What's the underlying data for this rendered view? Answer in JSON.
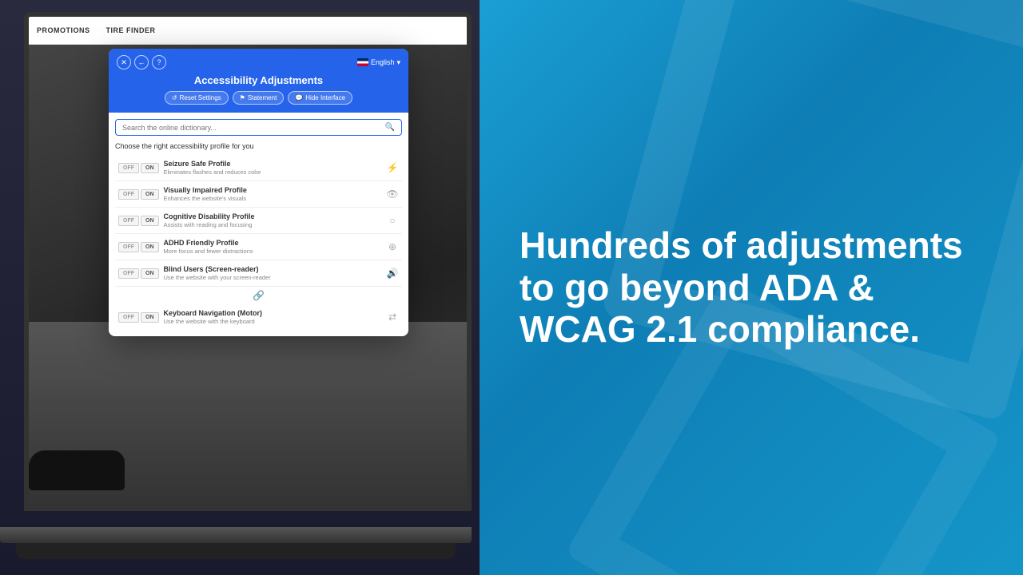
{
  "nav": {
    "items": [
      "PROMOTIONS",
      "TIRE FINDER"
    ]
  },
  "modal": {
    "title": "Accessibility Adjustments",
    "lang_label": "English",
    "buttons": {
      "reset": "Reset Settings",
      "statement": "Statement",
      "hide": "Hide Interface"
    },
    "search_placeholder": "Search the online dictionary...",
    "profile_section_title": "Choose the right accessibility profile for you",
    "profiles": [
      {
        "name": "Seizure Safe Profile",
        "desc": "Eliminates flashes and reduces color",
        "icon": "⚡"
      },
      {
        "name": "Visually Impaired Profile",
        "desc": "Enhances the website's visuals",
        "icon": "👁"
      },
      {
        "name": "Cognitive Disability Profile",
        "desc": "Assists with reading and focusing",
        "icon": "○"
      },
      {
        "name": "ADHD Friendly Profile",
        "desc": "More focus and fewer distractions",
        "icon": "⊕"
      },
      {
        "name": "Blind Users (Screen-reader)",
        "desc": "Use the website with your screen-reader",
        "icon": "🔊"
      },
      {
        "name": "Keyboard Navigation (Motor)",
        "desc": "Use the website with the keyboard",
        "icon": "⇄"
      }
    ]
  },
  "hero": {
    "text": "Hundreds of adjustments to go beyond ADA & WCAG 2.1 compliance."
  }
}
